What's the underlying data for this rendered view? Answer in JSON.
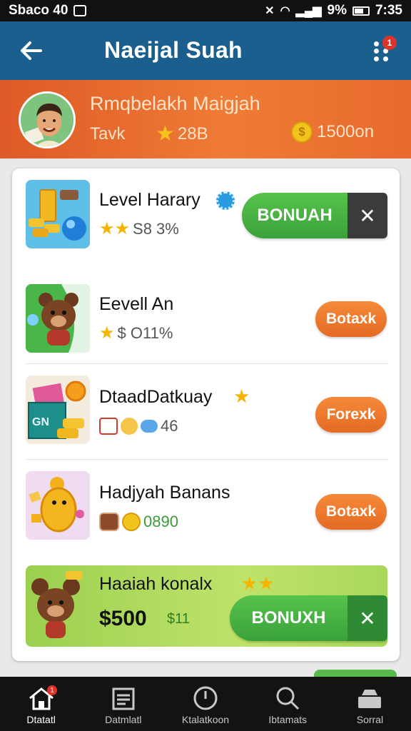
{
  "status_bar": {
    "carrier": "Sbaco 40",
    "battery_text": "9%",
    "time": "7:35"
  },
  "app_bar": {
    "title": "Naeijal Suah",
    "menu_badge": "1"
  },
  "profile": {
    "name": "Rmqbelakh Maigjah",
    "rank_label": "Tavk",
    "stars": "28B",
    "coins": "1500on",
    "coin_symbol": "$"
  },
  "list": [
    {
      "title": "Level Harary",
      "sub": "S8 3%",
      "button": "BONUAH",
      "button_style": "green"
    },
    {
      "title": "Eevell An",
      "sub": "$ O11%",
      "button": "Botaxk",
      "button_style": "orange"
    },
    {
      "title": "DtaadDatkuay",
      "sub": "46",
      "button": "Forexk",
      "button_style": "orange"
    },
    {
      "title": "Hadjyah Banans",
      "sub": "0890",
      "button": "Botaxk",
      "button_style": "orange"
    }
  ],
  "promo": {
    "title": "Haaiah konalx",
    "amount": "$500",
    "sub": "$11",
    "button": "BONUXH"
  },
  "nav": [
    {
      "label": "Dtatatl",
      "icon": "home-icon",
      "badge": "1"
    },
    {
      "label": "Datmlatl",
      "icon": "list-icon"
    },
    {
      "label": "Ktalatkoon",
      "icon": "clock-icon"
    },
    {
      "label": "Ibtamats",
      "icon": "search-icon"
    },
    {
      "label": "Sorral",
      "icon": "inbox-icon"
    }
  ],
  "colors": {
    "app_bar": "#1b5f8f",
    "profile_bar": "#e86a2d",
    "green_button": "#3aa23b",
    "orange_button": "#e56a22"
  }
}
